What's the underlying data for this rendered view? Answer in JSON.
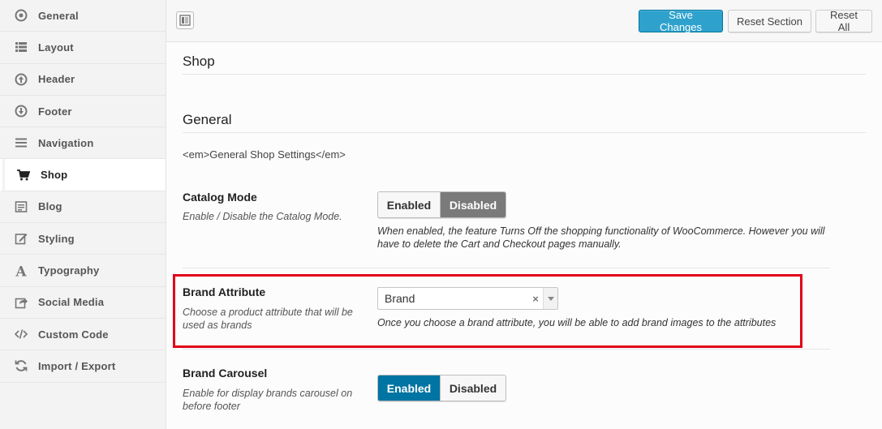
{
  "sidebar": {
    "items": [
      {
        "label": "General",
        "icon": "circle-dot-icon",
        "active": false
      },
      {
        "label": "Layout",
        "icon": "list-icon",
        "active": false
      },
      {
        "label": "Header",
        "icon": "arrow-up-circle-icon",
        "active": false
      },
      {
        "label": "Footer",
        "icon": "arrow-down-circle-icon",
        "active": false
      },
      {
        "label": "Navigation",
        "icon": "menu-icon",
        "active": false
      },
      {
        "label": "Shop",
        "icon": "cart-icon",
        "active": true
      },
      {
        "label": "Blog",
        "icon": "blog-icon",
        "active": false
      },
      {
        "label": "Styling",
        "icon": "edit-icon",
        "active": false
      },
      {
        "label": "Typography",
        "icon": "typography-icon",
        "active": false
      },
      {
        "label": "Social Media",
        "icon": "share-icon",
        "active": false
      },
      {
        "label": "Custom Code",
        "icon": "code-icon",
        "active": false
      },
      {
        "label": "Import / Export",
        "icon": "refresh-icon",
        "active": false
      }
    ]
  },
  "toolbar": {
    "save_label": "Save Changes",
    "reset_section_label": "Reset Section",
    "reset_all_label": "Reset All"
  },
  "main": {
    "page_title": "Shop",
    "section_title": "General",
    "section_desc": "<em>General Shop Settings</em>",
    "catalog_mode": {
      "label": "Catalog Mode",
      "help": "Enable / Disable the Catalog Mode.",
      "options": [
        "Enabled",
        "Disabled"
      ],
      "selected": "Disabled",
      "note": "When enabled, the feature Turns Off the shopping functionality of WooCommerce. However you will have to delete the Cart and Checkout pages manually."
    },
    "brand_attribute": {
      "label": "Brand Attribute",
      "help": "Choose a product attribute that will be used as brands",
      "value": "Brand",
      "clear_symbol": "×",
      "note": "Once you choose a brand attribute, you will be able to add brand images to the attributes"
    },
    "brand_carousel": {
      "label": "Brand Carousel",
      "help": "Enable for display brands carousel on before footer",
      "options": [
        "Enabled",
        "Disabled"
      ],
      "selected": "Enabled"
    }
  },
  "colors": {
    "primary": "#2ea2cc",
    "enabled_on": "#0074a2",
    "disabled_on": "#7a7a7a",
    "highlight": "#e2001a"
  }
}
